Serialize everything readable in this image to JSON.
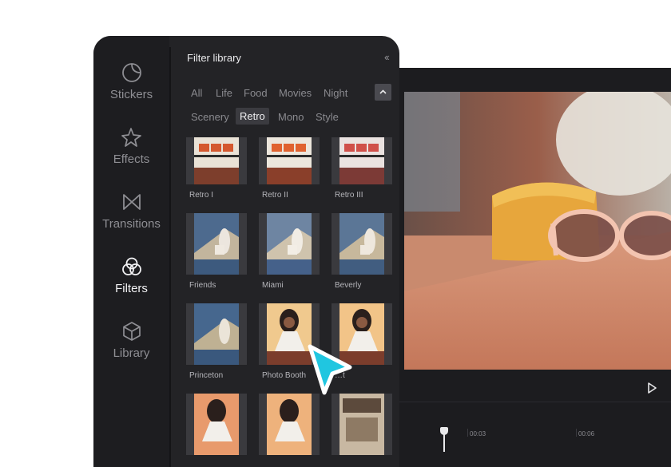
{
  "panel": {
    "title": "Filter library",
    "collapse_icon": "double-chevron-left-icon"
  },
  "rail": {
    "items": [
      {
        "label": "Stickers",
        "icon": "sticker-icon",
        "active": false
      },
      {
        "label": "Effects",
        "icon": "sparkle-star-icon",
        "active": false
      },
      {
        "label": "Transitions",
        "icon": "bowtie-icon",
        "active": false
      },
      {
        "label": "Filters",
        "icon": "filters-circles-icon",
        "active": true
      },
      {
        "label": "Library",
        "icon": "cube-icon",
        "active": false
      }
    ]
  },
  "categories": {
    "row1": [
      "All",
      "Life",
      "Food",
      "Movies",
      "Night"
    ],
    "row2": [
      "Scenery",
      "Retro",
      "Mono",
      "Style"
    ],
    "active": "Retro",
    "toggle_icon": "chevron-up-icon"
  },
  "filters": [
    {
      "label": "Retro I"
    },
    {
      "label": "Retro II"
    },
    {
      "label": "Retro III"
    },
    {
      "label": "Friends"
    },
    {
      "label": "Miami"
    },
    {
      "label": "Beverly"
    },
    {
      "label": "Princeton"
    },
    {
      "label": "Photo Booth"
    },
    {
      "label": "…t"
    },
    {
      "label": ""
    },
    {
      "label": ""
    },
    {
      "label": ""
    }
  ],
  "player": {
    "play_icon": "play-icon"
  },
  "timeline": {
    "ticks": [
      "00:03",
      "00:06"
    ]
  },
  "colors": {
    "panel_bg": "#232326",
    "rail_bg": "#1d1d20",
    "cursor": "#20c6e0"
  }
}
